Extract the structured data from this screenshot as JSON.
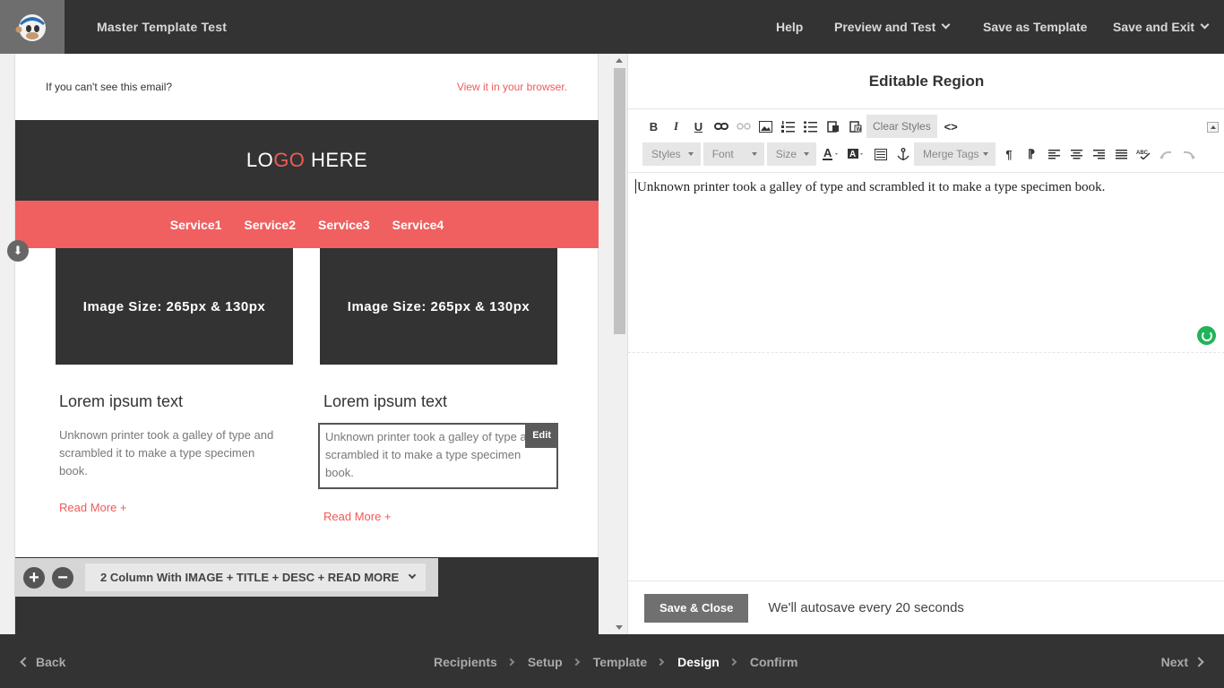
{
  "app": {
    "title": "Master Template Test"
  },
  "top_nav": {
    "help": "Help",
    "preview": "Preview and Test",
    "save_template": "Save as Template",
    "save_exit": "Save and Exit"
  },
  "email": {
    "preheader_left": "If you can't see this email?",
    "preheader_right": "View it in your browser.",
    "logo_part1": "LO",
    "logo_part2": "GO",
    "logo_part3": " HERE",
    "nav": [
      "Service1",
      "Service2",
      "Service3",
      "Service4"
    ],
    "columns": [
      {
        "image_label": "Image Size: 265px & 130px",
        "title": "Lorem ipsum text",
        "desc": "Unknown printer took a galley of type and scrambled it to make a type specimen book.",
        "read_more": "Read More +"
      },
      {
        "image_label": "Image Size: 265px & 130px",
        "title": "Lorem ipsum text",
        "desc": "Unknown printer took a galley of type and scrambled it to make a type specimen book.",
        "read_more": "Read More +",
        "edit_label": "Edit"
      }
    ],
    "block_toolbar": {
      "add": "+",
      "remove": "−",
      "block_name": "2 Column With IMAGE + TITLE + DESC + READ MORE"
    }
  },
  "editor": {
    "title": "Editable Region",
    "toolbar1": {
      "bold": "B",
      "italic": "I",
      "underline": "U",
      "clear_styles": "Clear Styles",
      "source": "<>"
    },
    "toolbar2": {
      "styles": "Styles",
      "font": "Font",
      "size": "Size",
      "merge_tags": "Merge Tags"
    },
    "content": "Unknown printer took a galley of type and scrambled it to make a type specimen book.",
    "save_close": "Save & Close",
    "autosave": "We'll autosave every 20 seconds"
  },
  "bottom_nav": {
    "back": "Back",
    "next": "Next",
    "steps": [
      "Recipients",
      "Setup",
      "Template",
      "Design",
      "Confirm"
    ],
    "active_step": "Design"
  },
  "colors": {
    "accent": "#f05a5a",
    "dark": "#333333",
    "status": "#20b35a"
  }
}
